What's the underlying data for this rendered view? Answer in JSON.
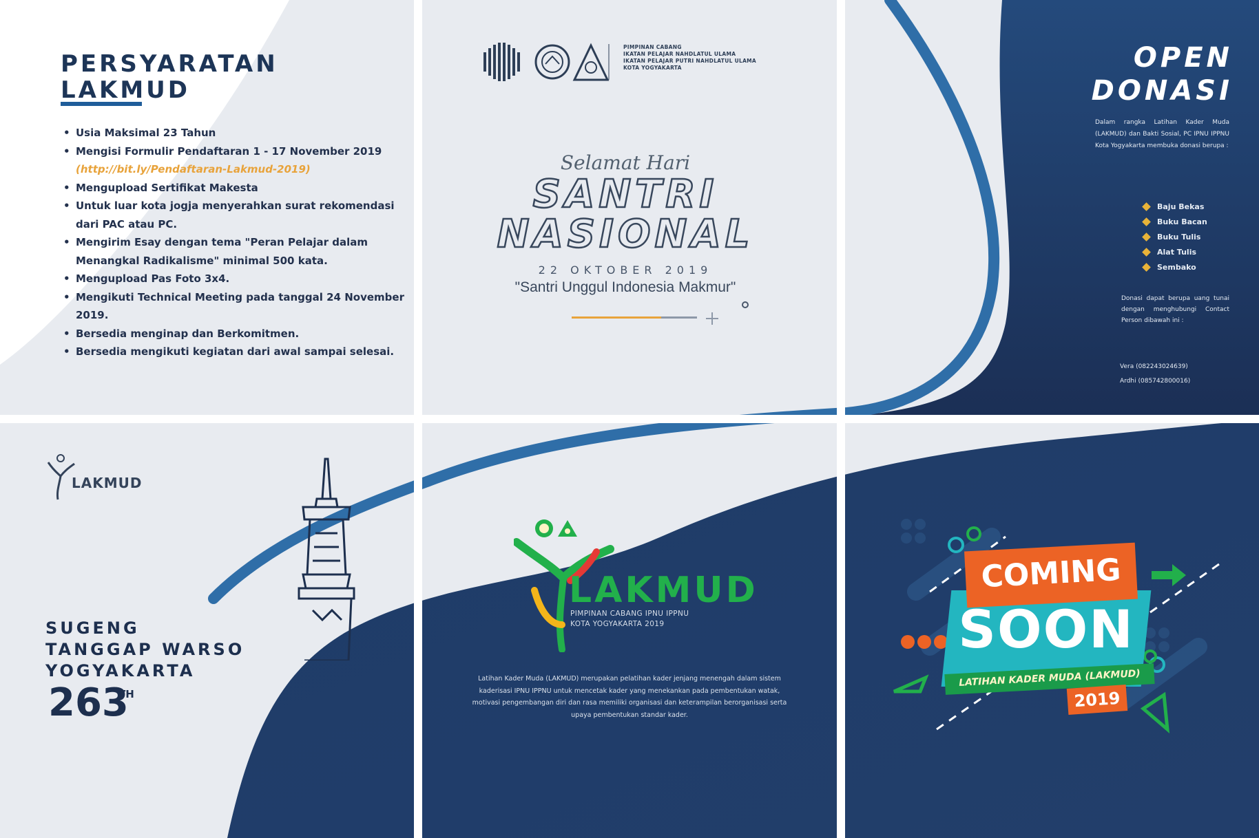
{
  "colors": {
    "navy": "#1d3557",
    "light_bg": "#e8ebf0",
    "blue_stripe": "#2f6ea8",
    "accent_orange": "#e8a33b",
    "green": "#22b04b",
    "coming_orange": "#ec6325",
    "soon_teal": "#23b6c0"
  },
  "tile_requirements": {
    "title_line1": "PERSYARATAN",
    "title_line2": "LAKMUD",
    "items": [
      "Usia Maksimal 23 Tahun",
      "Mengisi Formulir Pendaftaran 1 - 17 November 2019",
      "Mengupload Sertifikat Makesta",
      "Untuk luar kota jogja menyerahkan surat rekomendasi dari PAC atau PC.",
      "Mengirim Esay dengan tema \"Peran Pelajar dalam Menangkal Radikalisme\" minimal 500 kata.",
      "Mengupload Pas Foto 3x4.",
      "Mengikuti Technical Meeting pada tanggal 24 November 2019.",
      "Bersedia menginap dan Berkomitmen.",
      "Bersedia mengikuti kegiatan dari awal sampai selesai."
    ],
    "link": "(http://bit.ly/Pendaftaran-Lakmud-2019)"
  },
  "tile_santri": {
    "org_lines": [
      "PIMPINAN CABANG",
      "IKATAN PELAJAR NAHDLATUL ULAMA",
      "IKATAN PELAJAR PUTRI NAHDLATUL ULAMA",
      "KOTA YOGYAKARTA"
    ],
    "greeting": "Selamat Hari",
    "title_line1": "SANTRI",
    "title_line2": "NASIONAL",
    "date": "22 OKTOBER 2019",
    "tagline": "\"Santri Unggul Indonesia Makmur\""
  },
  "tile_donasi": {
    "title_line1": "OPEN",
    "title_line2": "DONASI",
    "intro": "Dalam rangka Latihan Kader Muda (LAKMUD) dan Bakti Sosial, PC IPNU IPPNU Kota Yogyakarta membuka donasi berupa :",
    "items": [
      "Baju Bekas",
      "Buku Bacan",
      "Buku Tulis",
      "Alat Tulis",
      "Sembako"
    ],
    "note": "Donasi dapat berupa uang tunai dengan menghubungi Contact Person dibawah ini :",
    "contacts": [
      "Vera (082243024639)",
      "Ardhi (085742800016)"
    ]
  },
  "tile_jogja": {
    "logo_text": "LAKMUD",
    "line1": "SUGENG",
    "line2": "TANGGAP WARSO",
    "line3": "YOGYAKARTA",
    "year": "263",
    "suffix": "TH"
  },
  "tile_lakmud": {
    "brand": "LAKMUD",
    "sub_line1": "PIMPINAN CABANG IPNU IPPNU",
    "sub_line2": "KOTA YOGYAKARTA 2019",
    "description": "Latihan Kader Muda (LAKMUD) merupakan pelatihan kader jenjang menengah dalam sistem kaderisasi IPNU IPPNU untuk mencetak kader yang menekankan pada pembentukan watak, motivasi pengembangan diri dan rasa memiliki organisasi dan keterampilan berorganisasi serta upaya pembentukan standar kader."
  },
  "tile_coming": {
    "coming": "COMING",
    "soon": "SOON",
    "ribbon": "LATIHAN KADER MUDA (LAKMUD)",
    "year": "2019"
  }
}
